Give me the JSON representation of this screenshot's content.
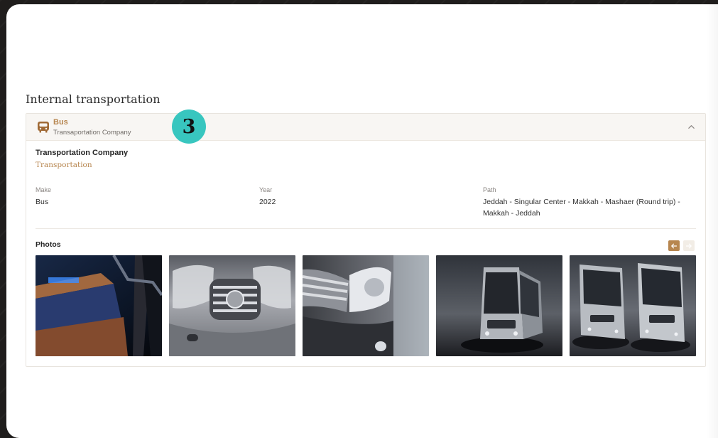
{
  "section": {
    "title": "Internal transportation"
  },
  "card": {
    "title": "Bus",
    "subtitle": "Transaportation Company",
    "step": "3"
  },
  "company": {
    "title": "Transportation Company",
    "subtitle": "Transportation"
  },
  "details": {
    "make_label": "Make",
    "make_value": "Bus",
    "year_label": "Year",
    "year_value": "2022",
    "path_label": "Path",
    "path_value": "Jeddah - Singular Center - Makkah - Mashaer (Round trip) - Makkah - Jeddah"
  },
  "photos": {
    "label": "Photos"
  },
  "colors": {
    "accent": "#b7864f",
    "badge": "#38c6bf"
  }
}
